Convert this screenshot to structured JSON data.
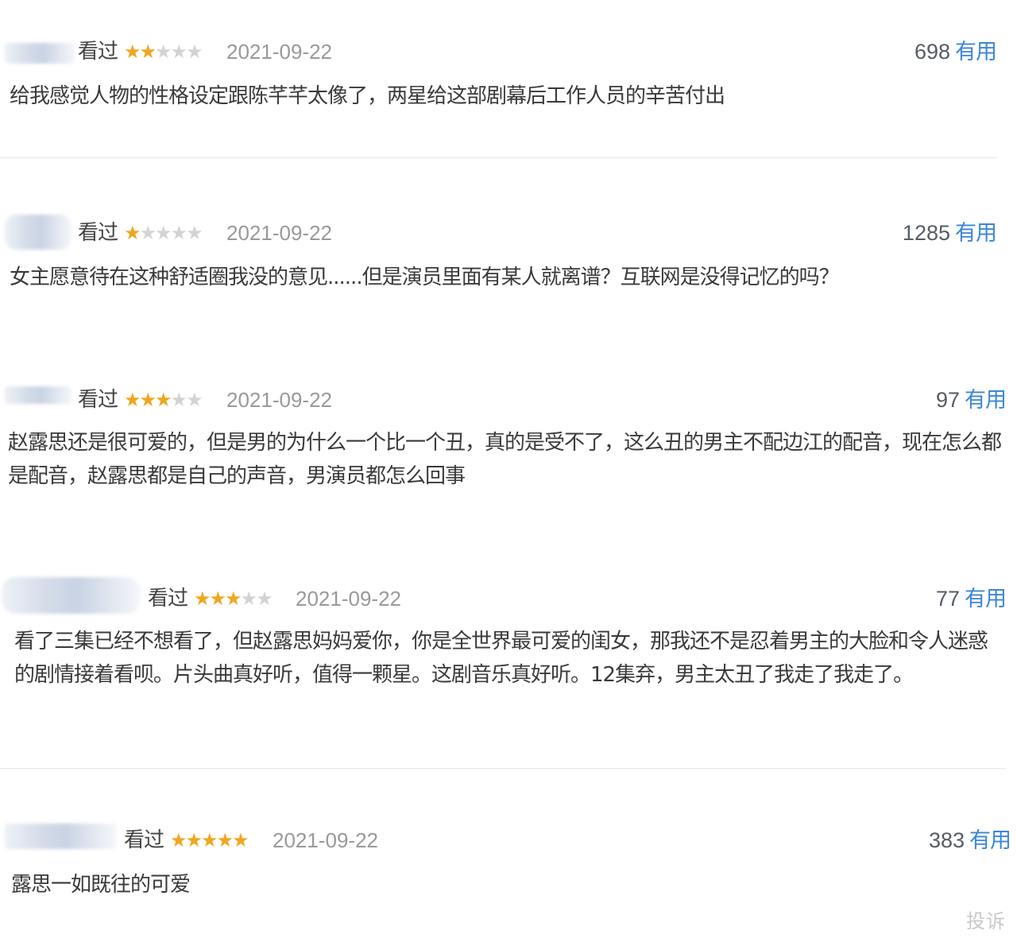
{
  "reviews": [
    {
      "status": "看过",
      "stars": [
        "on",
        "on",
        "off",
        "off",
        "off"
      ],
      "date": "2021-09-22",
      "votes": "698",
      "useful_label": "有用",
      "content": "给我感觉人物的性格设定跟陈芊芊太像了，两星给这部剧幕后工作人员的辛苦付出"
    },
    {
      "status": "看过",
      "stars": [
        "on",
        "off",
        "off",
        "off",
        "off"
      ],
      "date": "2021-09-22",
      "votes": "1285",
      "useful_label": "有用",
      "content": "女主愿意待在这种舒适圈我没的意见......但是演员里面有某人就离谱？互联网是没得记忆的吗？"
    },
    {
      "status": "看过",
      "stars": [
        "on",
        "on",
        "on",
        "off",
        "off"
      ],
      "date": "2021-09-22",
      "votes": "97",
      "useful_label": "有用",
      "content": "赵露思还是很可爱的，但是男的为什么一个比一个丑，真的是受不了，这么丑的男主不配边江的配音，现在怎么都是配音，赵露思都是自己的声音，男演员都怎么回事"
    },
    {
      "status": "看过",
      "stars": [
        "on",
        "on",
        "on",
        "off",
        "off"
      ],
      "date": "2021-09-22",
      "votes": "77",
      "useful_label": "有用",
      "content": "看了三集已经不想看了，但赵露思妈妈爱你，你是全世界最可爱的闺女，那我还不是忍着男主的大脸和令人迷惑的剧情接着看呗。片头曲真好听，值得一颗星。这剧音乐真好听。12集弃，男主太丑了我走了我走了。"
    },
    {
      "status": "看过",
      "stars": [
        "on",
        "on",
        "on",
        "on",
        "on"
      ],
      "date": "2021-09-22",
      "votes": "383",
      "useful_label": "有用",
      "content": "露思一如既往的可爱"
    }
  ],
  "complaint_label": "投诉"
}
